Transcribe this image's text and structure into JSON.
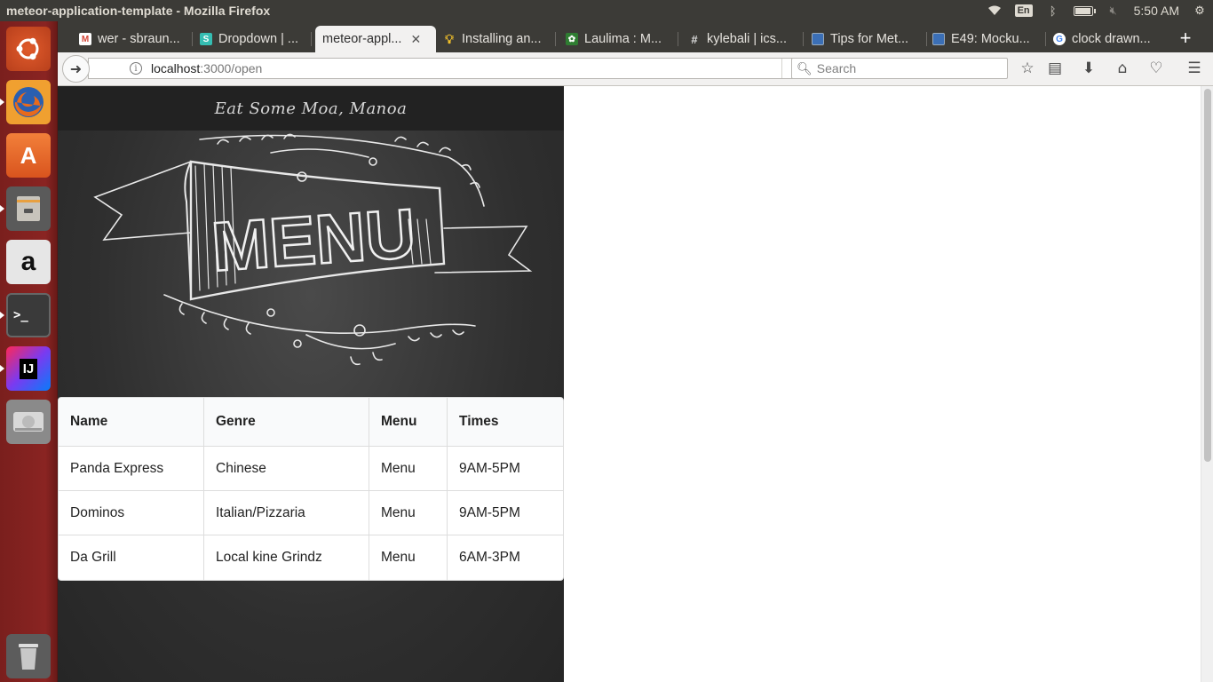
{
  "window": {
    "title": "meteor-application-template - Mozilla Firefox"
  },
  "system_tray": {
    "keyboard_layout": "En",
    "clock": "5:50 AM",
    "battery_level": 0.85
  },
  "launcher": {
    "items": [
      {
        "name": "ubuntu-dash",
        "label": ""
      },
      {
        "name": "firefox",
        "label": ""
      },
      {
        "name": "software-center",
        "label": "A"
      },
      {
        "name": "files",
        "label": ""
      },
      {
        "name": "amazon",
        "label": "a"
      },
      {
        "name": "terminal",
        "label": ">_"
      },
      {
        "name": "intellij",
        "label": "IJ"
      },
      {
        "name": "disk",
        "label": ""
      },
      {
        "name": "trash",
        "label": ""
      }
    ]
  },
  "tabs": [
    {
      "label": "wer - sbraun...",
      "icon": "gmail-icon",
      "color": "#d44638"
    },
    {
      "label": "Dropdown | ...",
      "icon": "semantic-icon",
      "color": "#35bdb2"
    },
    {
      "label": "meteor-appl...",
      "icon": "",
      "color": "",
      "active": true
    },
    {
      "label": "Installing an...",
      "icon": "bulb-icon",
      "color": "#f2c029"
    },
    {
      "label": "Laulima : M...",
      "icon": "leaf-icon",
      "color": "#2f7d32"
    },
    {
      "label": "kylebali | ics...",
      "icon": "slack-icon",
      "color": "#4a154b"
    },
    {
      "label": "Tips for Met...",
      "icon": "page-icon",
      "color": "#3b6fb6"
    },
    {
      "label": "E49: Mocku...",
      "icon": "page-icon",
      "color": "#3b6fb6"
    },
    {
      "label": "clock drawn...",
      "icon": "google-icon",
      "color": "#4285f4"
    }
  ],
  "navbar": {
    "url_host": "localhost",
    "url_path": ":3000/open",
    "search_placeholder": "Search"
  },
  "app": {
    "brand": "Eat Some Moa, Manoa",
    "banner_text": "MENU",
    "table": {
      "headers": [
        "Name",
        "Genre",
        "Menu",
        "Times"
      ],
      "rows": [
        [
          "Panda Express",
          "Chinese",
          "Menu",
          "9AM-5PM"
        ],
        [
          "Dominos",
          "Italian/Pizzaria",
          "Menu",
          "9AM-5PM"
        ],
        [
          "Da Grill",
          "Local kine Grindz",
          "Menu",
          "6AM-3PM"
        ]
      ]
    }
  },
  "colors": {
    "chalkboard": "#2f2f2f",
    "header": "#222222",
    "launcher": "#8a2422",
    "titlebar": "#3c3b37"
  }
}
